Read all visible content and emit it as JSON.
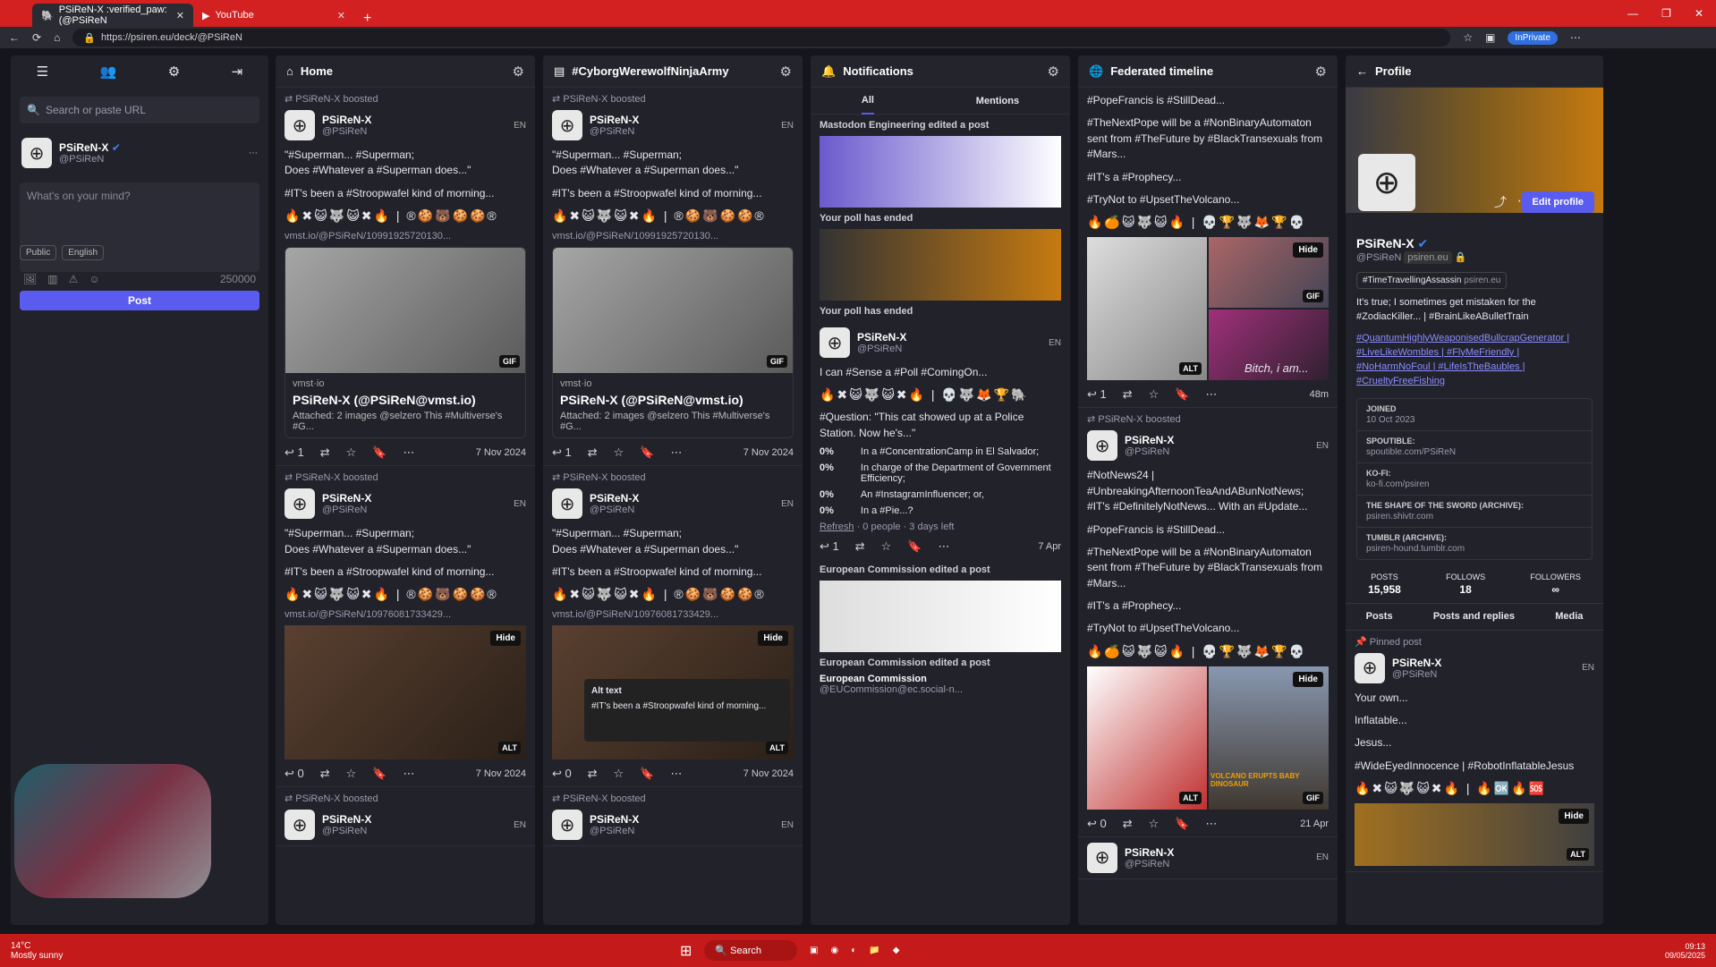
{
  "browser": {
    "tab1": "PSiReN-X :verified_paw: (@PSiReN",
    "tab2": "YouTube",
    "url": "https://psiren.eu/deck/@PSiReN",
    "inprivate": "InPrivate"
  },
  "left": {
    "search_placeholder": "Search or paste URL",
    "name": "PSiReN-X",
    "handle": "@PSiReN",
    "compose_placeholder": "What's on your mind?",
    "visibility": "Public",
    "language": "English",
    "counter": "250000",
    "post": "Post"
  },
  "home": {
    "title": "Home",
    "s1": {
      "booster": "PSiReN-X",
      "boosted": "boosted",
      "name": "PSiReN-X",
      "handle": "@PSiReN",
      "lang": "EN",
      "t1": "\"#Superman... #Superman;",
      "t2": "Does #Whatever a #Superman does...\"",
      "t3": "#IT's been a #Stroopwafel kind of morning...",
      "emoji": "🔥✖😺🐺😺✖🔥 | ®🍪🐻🍪🍪®",
      "link": "vmst.io/@PSiReN/10991925720130...",
      "card_site": "vmst·io",
      "card_title": "PSiReN-X (@PSiReN@vmst.io)",
      "card_desc": "Attached: 2 images @selzero This #Multiverse's #G...",
      "gif": "GIF",
      "replies": "1",
      "date": "7 Nov 2024"
    },
    "s2": {
      "booster": "PSiReN-X",
      "boosted": "boosted",
      "name": "PSiReN-X",
      "handle": "@PSiReN",
      "lang": "EN",
      "t1": "\"#Superman... #Superman;",
      "t2": "Does #Whatever a #Superman does...\"",
      "t3": "#IT's been a #Stroopwafel kind of morning...",
      "emoji": "🔥✖😺🐺😺✖🔥 | ®🍪🐻🍪🍪®",
      "link": "vmst.io/@PSiReN/10976081733429...",
      "hide": "Hide",
      "alt": "ALT",
      "replies": "0",
      "date": "7 Nov 2024"
    },
    "s3": {
      "booster": "PSiReN-X",
      "boosted": "boosted",
      "name": "PSiReN-X",
      "handle": "@PSiReN",
      "lang": "EN"
    }
  },
  "cyber": {
    "title": "#CyborgWerewolfNinjaArmy",
    "s1": {
      "booster": "PSiReN-X",
      "boosted": "boosted",
      "name": "PSiReN-X",
      "handle": "@PSiReN",
      "lang": "EN",
      "t1": "\"#Superman... #Superman;",
      "t2": "Does #Whatever a #Superman does...\"",
      "t3": "#IT's been a #Stroopwafel kind of morning...",
      "emoji": "🔥✖😺🐺😺✖🔥 | ®🍪🐻🍪🍪®",
      "link": "vmst.io/@PSiReN/10991925720130...",
      "card_site": "vmst·io",
      "card_title": "PSiReN-X (@PSiReN@vmst.io)",
      "card_desc": "Attached: 2 images @selzero This #Multiverse's #G...",
      "gif": "GIF",
      "replies": "1",
      "date": "7 Nov 2024"
    },
    "s2": {
      "booster": "PSiReN-X",
      "boosted": "boosted",
      "name": "PSiReN-X",
      "handle": "@PSiReN",
      "lang": "EN",
      "t1": "\"#Superman... #Superman;",
      "t2": "Does #Whatever a #Superman does...\"",
      "t3": "#IT's been a #Stroopwafel kind of morning...",
      "emoji": "🔥✖😺🐺😺✖🔥 | ®🍪🐻🍪🍪®",
      "link": "vmst.io/@PSiReN/10976081733429...",
      "hide": "Hide",
      "alt_title": "Alt text",
      "alt_text": "#IT's been a #Stroopwafel kind of morning...",
      "alt": "ALT",
      "replies": "0",
      "date": "7 Nov 2024"
    },
    "s3": {
      "booster": "PSiReN-X",
      "boosted": "boosted",
      "name": "PSiReN-X",
      "handle": "@PSiReN",
      "lang": "EN"
    }
  },
  "notif": {
    "title": "Notifications",
    "tab_all": "All",
    "tab_mentions": "Mentions",
    "n1": "Mastodon Engineering edited a post",
    "n2": "Your poll has ended",
    "n3": "Your poll has ended",
    "poll_name": "PSiReN-X",
    "poll_handle": "@PSiReN",
    "poll_lang": "EN",
    "poll_t1": "I can #Sense a #Poll #ComingOn...",
    "poll_emoji": "🔥✖😺🐺😺✖🔥 | 💀🐺🦊🏆🐘",
    "poll_q": "#Question: \"This cat showed up at a Police Station. Now he's...\"",
    "o1p": "0%",
    "o1": "In a #ConcentrationCamp in El Salvador;",
    "o2p": "0%",
    "o2": "In charge of the Department of Government Efficiency;",
    "o3p": "0%",
    "o3": "An #InstagramInfluencer; or,",
    "o4p": "0%",
    "o4": "In a #Pie...?",
    "refresh": "Refresh",
    "poll_meta": " · 0 people · 3 days left",
    "replies": "1",
    "date": "7 Apr",
    "n4": "European Commission edited a post",
    "n5": "European Commission edited a post",
    "ec_name": "European Commission",
    "ec_handle": "@EUCommission@ec.social-n..."
  },
  "fed": {
    "title": "Federated timeline",
    "p1": "#PopeFrancis is #StillDead...",
    "p2": "#TheNextPope will be a #NonBinaryAutomaton sent from #TheFuture by #BlackTransexuals from #Mars...",
    "p3": "#IT's a #Prophecy...",
    "p4": "#TryNot to #UpsetTheVolcano...",
    "emoji": "🔥🍊😺🐺😺🔥 | 💀🏆🐺🦊🏆💀",
    "hide": "Hide",
    "alt": "ALT",
    "gif": "GIF",
    "bitch": "Bitch, i am...",
    "replies": "1",
    "date": "48m",
    "s2": {
      "booster": "PSiReN-X",
      "boosted": "boosted",
      "name": "PSiReN-X",
      "handle": "@PSiReN",
      "lang": "EN",
      "t1": "#NotNews24 | #UnbreakingAfternoonTeaAndABunNotNews; #IT's #DefinitelyNotNews... With an #Update...",
      "t2": "#PopeFrancis is #StillDead...",
      "t3": "#TheNextPope will be a #NonBinaryAutomaton sent from #TheFuture by #BlackTransexuals from #Mars...",
      "t4": "#IT's a #Prophecy...",
      "t5": "#TryNot to #UpsetTheVolcano...",
      "volcano": "VOLCANO ERUPTS BABY DINOSAUR",
      "replies": "0",
      "date": "21 Apr"
    },
    "s3": {
      "name": "PSiReN-X",
      "handle": "@PSiReN",
      "lang": "EN"
    }
  },
  "profile": {
    "title": "Profile",
    "edit": "Edit profile",
    "name": "PSiReN-X",
    "handle": "@PSiReN",
    "domain": "psiren.eu",
    "tag": "#TimeTravellingAssassin",
    "tagdomain": "psiren.eu",
    "bio1": "It's true; I sometimes get mistaken for the #ZodiacKiller... | #BrainLikeABulletTrain",
    "bio2": "#QuantumHighlyWeaponisedBullcrapGenerator | #LiveLikeWombles | #FlyMeFriendly | #NoHarmNoFoul | #LifeIsTheBaubles | #CrueltyFreeFishing",
    "joined_l": "JOINED",
    "joined": "10 Oct 2023",
    "f1l": "SPOUTIBLE:",
    "f1": "spoutible.com/PSiReN",
    "f2l": "KO-FI:",
    "f2": "ko-fi.com/psiren",
    "f3l": "THE SHAPE OF THE SWORD (ARCHIVE):",
    "f3": "psiren.shivtr.com",
    "f4l": "TUMBLR (ARCHIVE):",
    "f4": "psiren-hound.tumblr.com",
    "posts_l": "POSTS",
    "posts": "15,958",
    "follows_l": "FOLLOWS",
    "follows": "18",
    "followers_l": "FOLLOWERS",
    "followers": "∞",
    "tab1": "Posts",
    "tab2": "Posts and replies",
    "tab3": "Media",
    "pinned": "Pinned post",
    "pin_name": "PSiReN-X",
    "pin_handle": "@PSiReN",
    "pin_lang": "EN",
    "pin1": "Your own...",
    "pin2": "Inflatable...",
    "pin3": "Jesus...",
    "pin4": "#WideEyedInnocence | #RobotInflatableJesus",
    "pin_emoji": "🔥✖😺🐺😺✖🔥 | 🔥🆗🔥🆘",
    "hide": "Hide",
    "alt": "ALT"
  },
  "taskbar": {
    "temp": "14°C",
    "weather": "Mostly sunny",
    "search": "Search",
    "time": "09:13",
    "date": "09/05/2025"
  }
}
